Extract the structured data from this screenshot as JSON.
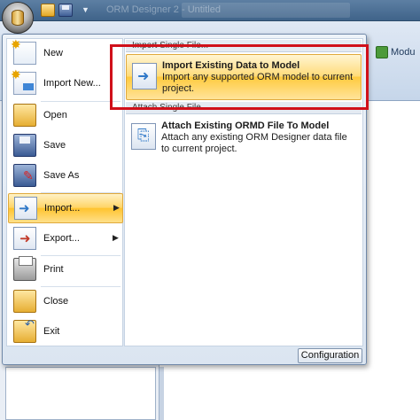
{
  "window": {
    "title": "ORM Designer 2 - Untitled"
  },
  "ribbon": {
    "module_label": "Modu"
  },
  "app_menu": {
    "items": [
      {
        "label": "New",
        "icon": "new-document-icon"
      },
      {
        "label": "Import New...",
        "icon": "import-new-icon"
      },
      {
        "label": "Open",
        "icon": "folder-open-icon"
      },
      {
        "label": "Save",
        "icon": "floppy-disk-icon"
      },
      {
        "label": "Save As",
        "icon": "save-as-icon"
      },
      {
        "label": "Import...",
        "icon": "import-icon",
        "has_submenu": true,
        "selected": true
      },
      {
        "label": "Export...",
        "icon": "export-icon",
        "has_submenu": true
      },
      {
        "label": "Print",
        "icon": "printer-icon"
      },
      {
        "label": "Close",
        "icon": "folder-close-icon"
      },
      {
        "label": "Exit",
        "icon": "exit-icon"
      }
    ],
    "submenu": {
      "sections": [
        {
          "header": "Import Single File...",
          "title": "Import Existing Data to Model",
          "description": "Import any supported ORM model to current project.",
          "highlighted": true
        },
        {
          "header": "Attach Single File",
          "title": "Attach Existing ORMD File To Model",
          "description": "Attach any existing ORM Designer data file to current project.",
          "highlighted": false
        }
      ]
    },
    "configuration_label": "Configuration"
  },
  "colors": {
    "highlight_border": "#d0101a",
    "selected_gradient": "#ffc32e"
  }
}
